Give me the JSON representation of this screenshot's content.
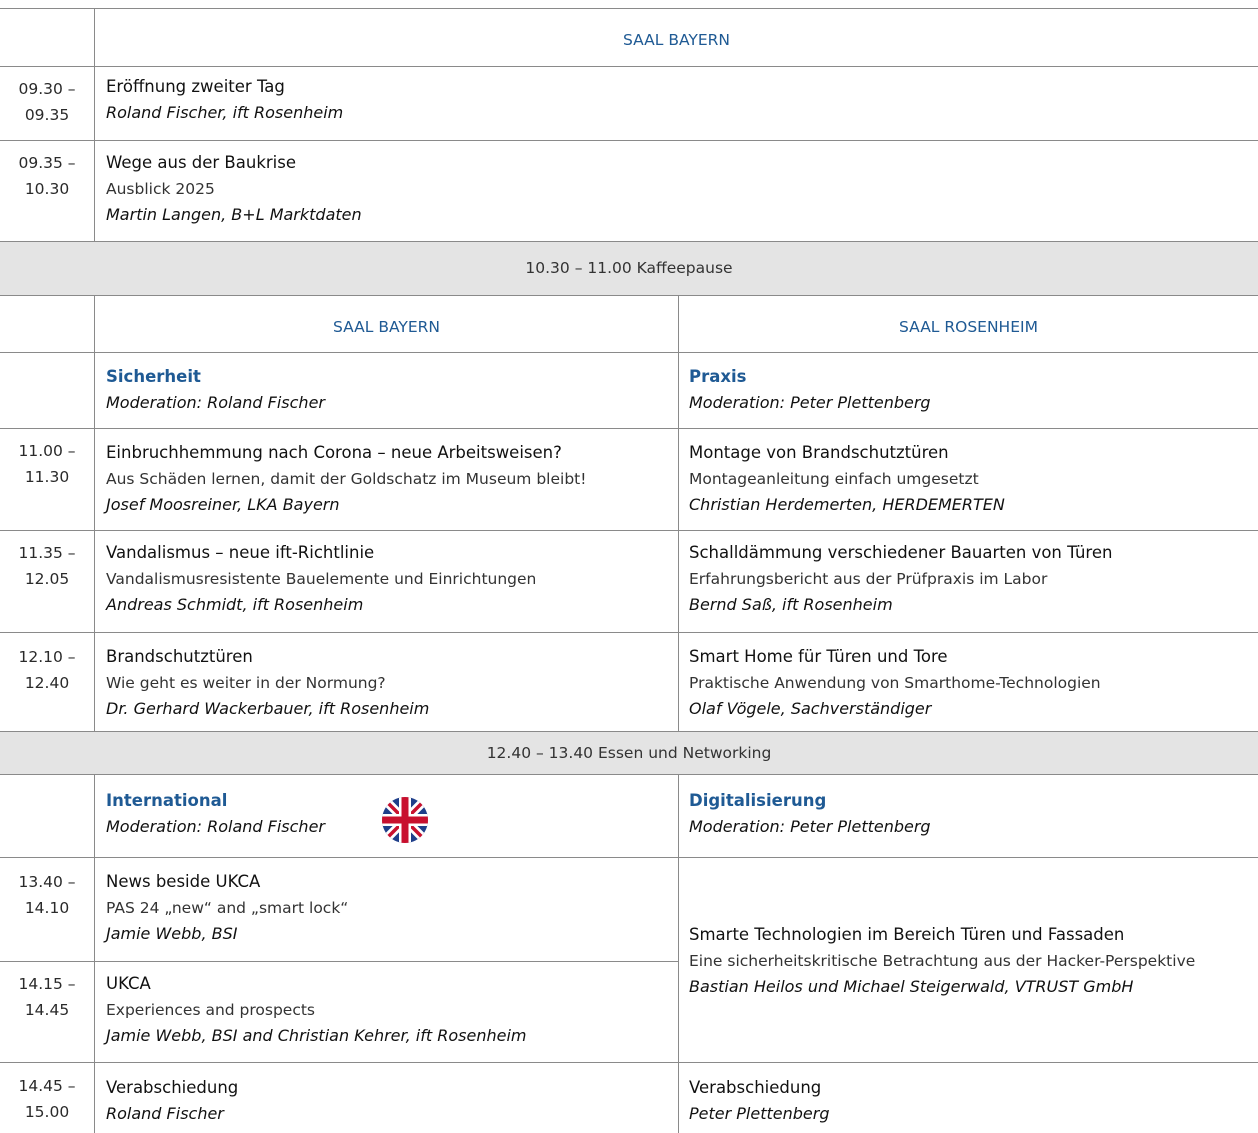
{
  "top_room": "SAAL BAYERN",
  "sessions_top": [
    {
      "time1": "09.30 –",
      "time2": "09.35",
      "title": "Eröffnung zweiter Tag",
      "subtitle": "",
      "speaker": "Roland Fischer, ift Rosenheim"
    },
    {
      "time1": "09.35 –",
      "time2": "10.30",
      "title": "Wege aus der Baukrise",
      "subtitle": "Ausblick 2025",
      "speaker": "Martin Langen, B+L Marktdaten"
    }
  ],
  "break1": "10.30 – 11.00  Kaffeepause",
  "rooms": {
    "left": "SAAL BAYERN",
    "right": "SAAL ROSENHEIM"
  },
  "track1": {
    "left": {
      "name": "Sicherheit",
      "moderation": "Moderation: Roland Fischer"
    },
    "right": {
      "name": "Praxis",
      "moderation": "Moderation: Peter Plettenberg"
    }
  },
  "sessions_mid": [
    {
      "time1": "11.00 –",
      "time2": "11.30",
      "left": {
        "title": "Einbruchhemmung nach Corona – neue Arbeitsweisen?",
        "subtitle": "Aus Schäden lernen, damit der Goldschatz im Museum bleibt!",
        "speaker": "Josef Moosreiner, LKA Bayern"
      },
      "right": {
        "title": "Montage von Brandschutztüren",
        "subtitle": "Montageanleitung einfach umgesetzt",
        "speaker": "Christian Herdemerten, HERDEMERTEN"
      }
    },
    {
      "time1": "11.35 –",
      "time2": "12.05",
      "left": {
        "title": "Vandalismus – neue ift-Richtlinie",
        "subtitle": "Vandalismusresistente Bauelemente und Einrichtungen",
        "speaker": "Andreas Schmidt, ift Rosenheim"
      },
      "right": {
        "title": "Schalldämmung verschiedener Bauarten von Türen",
        "subtitle": "Erfahrungsbericht aus der Prüfpraxis im Labor",
        "speaker": "Bernd Saß, ift Rosenheim"
      }
    },
    {
      "time1": "12.10 –",
      "time2": "12.40",
      "left": {
        "title": "Brandschutztüren",
        "subtitle": "Wie geht es weiter in der Normung?",
        "speaker": "Dr. Gerhard Wackerbauer, ift Rosenheim"
      },
      "right": {
        "title": "Smart Home für Türen und Tore",
        "subtitle": "Praktische Anwendung von Smarthome-Technologien",
        "speaker": "Olaf Vögele, Sachverständiger"
      }
    }
  ],
  "break2": "12.40 – 13.40  Essen und Networking",
  "track2": {
    "left": {
      "name": "International",
      "moderation": "Moderation: Roland Fischer",
      "flag_icon": "uk-flag-icon"
    },
    "right": {
      "name": "Digitalisierung",
      "moderation": "Moderation: Peter Plettenberg"
    }
  },
  "sessions_bottom": [
    {
      "time1": "13.40 –",
      "time2": "14.10",
      "title": "News beside UKCA",
      "subtitle": "PAS 24 „new“ and „smart lock“",
      "speaker": "Jamie Webb, BSI"
    },
    {
      "time1": "14.15 –",
      "time2": "14.45",
      "title": "UKCA",
      "subtitle": "Experiences and prospects",
      "speaker": "Jamie Webb, BSI and Christian Kehrer, ift Rosenheim"
    }
  ],
  "merged_right": {
    "title": "Smarte Technologien im Bereich Türen und Fassaden",
    "subtitle": "Eine sicherheitskritische Betrachtung aus der Hacker-Perspektive",
    "speaker": "Bastian Heilos und Michael Steigerwald, VTRUST GmbH"
  },
  "closing": {
    "time1": "14.45 –",
    "time2": "15.00",
    "left": {
      "title": "Verabschiedung",
      "speaker": "Roland Fischer"
    },
    "right": {
      "title": "Verabschiedung",
      "speaker": "Peter Plettenberg"
    }
  },
  "colors": {
    "accent": "#1f5a94",
    "band": "#e4e4e4",
    "rule": "#8a8a8a"
  }
}
